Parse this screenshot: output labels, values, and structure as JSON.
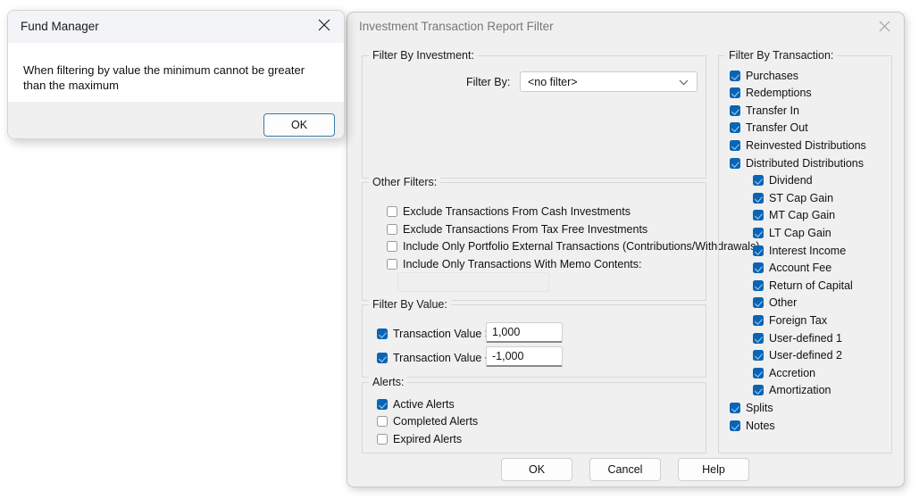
{
  "message_box": {
    "title": "Fund Manager",
    "text": "When filtering by value the minimum cannot be greater than the maximum",
    "ok_label": "OK",
    "close_icon": "close-icon"
  },
  "dialog": {
    "title": "Investment Transaction Report Filter",
    "close_icon": "close-icon",
    "filter_by_investment": {
      "legend": "Filter By Investment:",
      "filter_by_label": "Filter By:",
      "filter_by_value": "<no filter>",
      "chevron_icon": "chevron-down-icon"
    },
    "other_filters": {
      "legend": "Other Filters:",
      "items": [
        {
          "label": "Exclude Transactions From Cash Investments",
          "checked": false
        },
        {
          "label": "Exclude Transactions From Tax Free Investments",
          "checked": false
        },
        {
          "label": "Include Only Portfolio External Transactions (Contributions/Withdrawals)",
          "checked": false
        },
        {
          "label": "Include Only Transactions With Memo Contents:",
          "checked": false
        }
      ],
      "memo_value": "",
      "memo_placeholder": ""
    },
    "filter_by_value": {
      "legend": "Filter By Value:",
      "min": {
        "label": "Transaction Value >=",
        "checked": true,
        "value": "1,000"
      },
      "max": {
        "label": "Transaction Value <=",
        "checked": true,
        "value": "-1,000"
      }
    },
    "alerts": {
      "legend": "Alerts:",
      "items": [
        {
          "label": "Active Alerts",
          "checked": true
        },
        {
          "label": "Completed Alerts",
          "checked": false
        },
        {
          "label": "Expired Alerts",
          "checked": false
        }
      ]
    },
    "filter_by_transaction": {
      "legend": "Filter By Transaction:",
      "items": [
        {
          "label": "Purchases",
          "checked": true,
          "indent": 0
        },
        {
          "label": "Redemptions",
          "checked": true,
          "indent": 0
        },
        {
          "label": "Transfer In",
          "checked": true,
          "indent": 0
        },
        {
          "label": "Transfer Out",
          "checked": true,
          "indent": 0
        },
        {
          "label": "Reinvested Distributions",
          "checked": true,
          "indent": 0
        },
        {
          "label": "Distributed Distributions",
          "checked": true,
          "indent": 0
        },
        {
          "label": "Dividend",
          "checked": true,
          "indent": 1
        },
        {
          "label": "ST Cap Gain",
          "checked": true,
          "indent": 1
        },
        {
          "label": "MT Cap Gain",
          "checked": true,
          "indent": 1
        },
        {
          "label": "LT Cap Gain",
          "checked": true,
          "indent": 1
        },
        {
          "label": "Interest Income",
          "checked": true,
          "indent": 1
        },
        {
          "label": "Account Fee",
          "checked": true,
          "indent": 1
        },
        {
          "label": "Return of Capital",
          "checked": true,
          "indent": 1
        },
        {
          "label": "Other",
          "checked": true,
          "indent": 1
        },
        {
          "label": "Foreign Tax",
          "checked": true,
          "indent": 1
        },
        {
          "label": "User-defined 1",
          "checked": true,
          "indent": 1
        },
        {
          "label": "User-defined 2",
          "checked": true,
          "indent": 1
        },
        {
          "label": "Accretion",
          "checked": true,
          "indent": 1
        },
        {
          "label": "Amortization",
          "checked": true,
          "indent": 1
        },
        {
          "label": "Splits",
          "checked": true,
          "indent": 0
        },
        {
          "label": "Notes",
          "checked": true,
          "indent": 0
        }
      ]
    },
    "buttons": {
      "ok": "OK",
      "cancel": "Cancel",
      "help": "Help"
    }
  },
  "colors": {
    "accent": "#0a64b4",
    "dialog_bg": "#f0f0f0",
    "titlebar_bg": "#f3f4f7",
    "focus_border": "#3a7ca8"
  }
}
